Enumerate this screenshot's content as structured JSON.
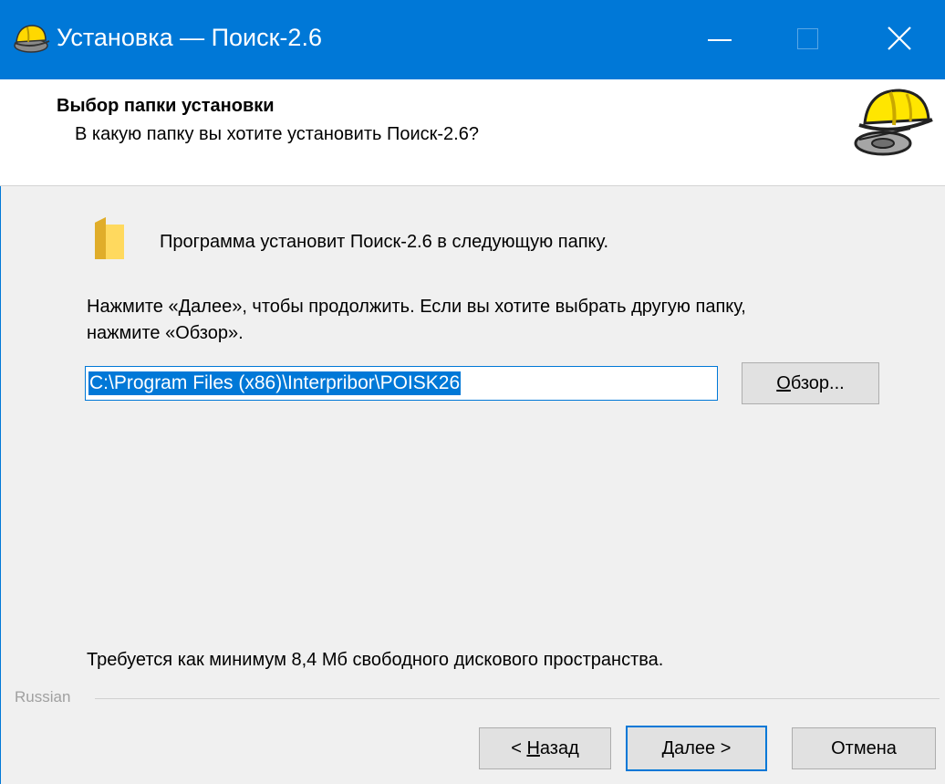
{
  "window": {
    "title": "Установка — Поиск-2.6"
  },
  "header": {
    "title": "Выбор папки установки",
    "subtitle": "В какую папку вы хотите установить Поиск-2.6?"
  },
  "content": {
    "main_text": "Программа установит Поиск-2.6 в следующую папку.",
    "hint_line1": "Нажмите «Далее», чтобы продолжить. Если вы хотите выбрать другую папку,",
    "hint_line2": "нажмите «Обзор».",
    "path_value": "C:\\Program Files (x86)\\Interpribor\\POISK26",
    "browse_accel": "О",
    "browse_rest": "бзор...",
    "space_text": "Требуется как минимум 8,4 Мб свободного дискового пространства."
  },
  "footer": {
    "language": "Russian",
    "back_prefix": "< ",
    "back_accel": "Н",
    "back_rest": "азад",
    "next_accel": "Д",
    "next_rest": "алее >",
    "cancel_label": "Отмена"
  },
  "icons": {
    "app": "hard-hat-icon",
    "folder": "folder-icon",
    "minimize": "minimize-icon",
    "maximize": "maximize-icon",
    "close": "close-icon"
  },
  "colors": {
    "accent": "#0078d7",
    "window_bg": "#f0f0f0",
    "header_bg": "#ffffff",
    "button_bg": "#e1e1e1",
    "folder": "#f5c842"
  }
}
